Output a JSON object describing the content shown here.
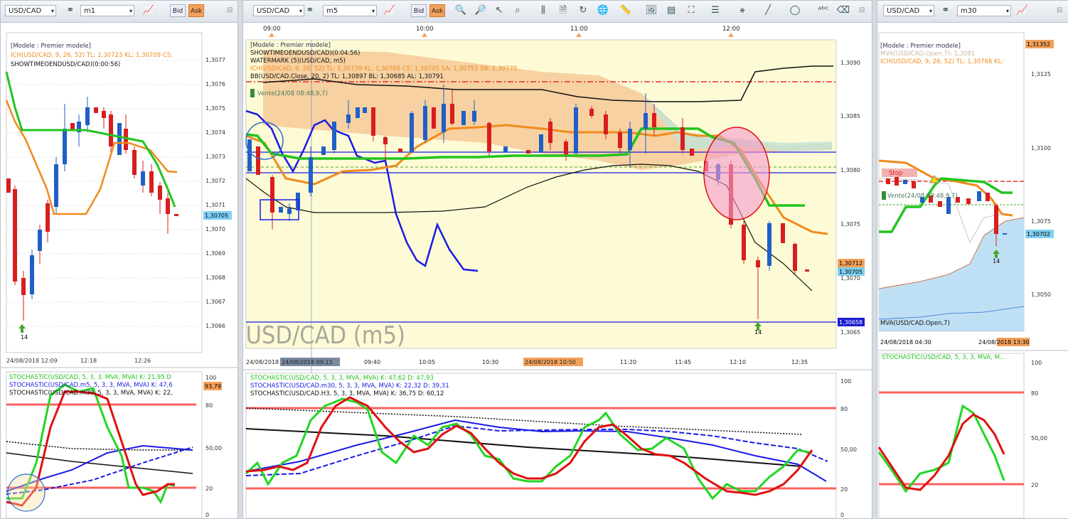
{
  "toolbar": {
    "left": {
      "symbol": "USD/CAD",
      "timeframe": "m1",
      "bid": "Bid",
      "ask": "Ask"
    },
    "middle": {
      "symbol": "USD/CAD",
      "timeframe": "m5",
      "bid": "Bid",
      "ask": "Ask"
    },
    "right": {
      "symbol": "USD/CAD",
      "timeframe": "m30"
    }
  },
  "left_chart": {
    "model": "[Modele : Premier modele]",
    "ich": "ICH(USD/CAD, 9, 26, 52)  TL: 1,30723   KL: 1,30709   CS:",
    "showtime": "SHOWTIMEOENDUSD/CAD)(0:00:56)",
    "price_labels": [
      "1,3077",
      "1,3076",
      "1,3075",
      "1,3074",
      "1,3073",
      "1,3072",
      "1,3071",
      "1,3070",
      "1,3069",
      "1,3068",
      "1,3067",
      "1,3066"
    ],
    "current_price": "1,30705",
    "time_labels": [
      "24/08/2018 12:09",
      "12:18",
      "12:26"
    ],
    "arrow_label": "14"
  },
  "left_stoch": {
    "line1": "STOCHASTIC(USD/CAD, 5, 3, 3, MVA, MVA)  K: 21,95  D",
    "line2": "STOCHASTIC(USD/CAD.m5, 5, 3, 3, MVA, MVA)  K: 47,6",
    "line3": "STOCHASTIC(USD/CAD.m30, 5, 3, 3, MVA, MVA)  K: 22,",
    "scale": [
      "100",
      "80",
      "50,00",
      "20",
      "0"
    ],
    "current": "93,79"
  },
  "middle_chart": {
    "time_top": [
      "09:00",
      "10:00",
      "11:00",
      "12:00"
    ],
    "model": "[Modele : Premier modele]",
    "showtime": "SHOWTIMEOENDUSD/CAD)(0:04:56)",
    "watermark": "WATERMARK (5)(USD/CAD, m5)",
    "ich": "ICH(USD/CAD, 9, 26, 52)  TL: 1,30739   KL: 1,30766   CS: 1,30705   SA: 1,30752   SB: 1,30770",
    "bb": "BB(USD/CAD.Close, 20, 2)  TL: 1,30897   BL: 1,30685   AL: 1,30791",
    "vente": "Vente(24/08 08:48,9,7)",
    "big_label": "USD/CAD (m5)",
    "price_labels": [
      "1,3090",
      "1,3085",
      "1,3080",
      "1,3075",
      "1,3070",
      "1,3065"
    ],
    "tag1": "1,30712",
    "tag2": "1,30705",
    "tag3": "1,30658",
    "time_labels": [
      "24/08/2018",
      "24/08/2018 09:15",
      "09:40",
      "10:05",
      "10:30",
      "24/08/2018 10:50",
      "11:20",
      "11:45",
      "12:10",
      "12:35"
    ],
    "arrow_label": "14"
  },
  "middle_stoch": {
    "line1": "STOCHASTIC(USD/CAD, 5, 3, 3, MVA, MVA)  K: 47,62   D: 47,93",
    "line2": "STOCHASTIC(USD/CAD.m30, 5, 3, 3, MVA, MVA)  K: 22,32   D: 39,31",
    "line3": "STOCHASTIC(USD/CAD.H3, 5, 3, 3, MVA, MVA)  K: 36,75   D: 60,12",
    "scale": [
      "100",
      "80",
      "50,00",
      "20",
      "0"
    ]
  },
  "right_chart": {
    "model": "[Modele : Premier modele]",
    "mva": "MVA(USD/CAD.Open,7):  1,3081",
    "ich": "ICH(USD/CAD, 9, 26, 52)  TL: 1,30766   KL:",
    "stop": "Stop",
    "vente": "Vente(24/08 08:48,9,7)",
    "mva_bottom": "MVA(USD/CAD.Open,7)",
    "price_labels": [
      "1,3125",
      "1,3100",
      "1,3075",
      "1,3050"
    ],
    "top_tag": "1,31352",
    "current_price": "1,30702",
    "time_labels": [
      "24/08/2018 04:30",
      "24/08/2018 13:30"
    ],
    "arrow_label": "14"
  },
  "right_stoch": {
    "line1": "STOCHASTIC(USD/CAD, 5, 3, 3, MVA, M...",
    "scale": [
      "100",
      "80",
      "50,00",
      "20"
    ]
  },
  "colors": {
    "ask": "#f3a15a",
    "bull": "#1f5fc7",
    "bear": "#d81e1e",
    "ich_tl": "#f08a1c",
    "ich_kl": "#22c41f",
    "stoch_k": "#22d622",
    "stoch_d": "#e01010",
    "blue_line": "#1a1ae6"
  }
}
